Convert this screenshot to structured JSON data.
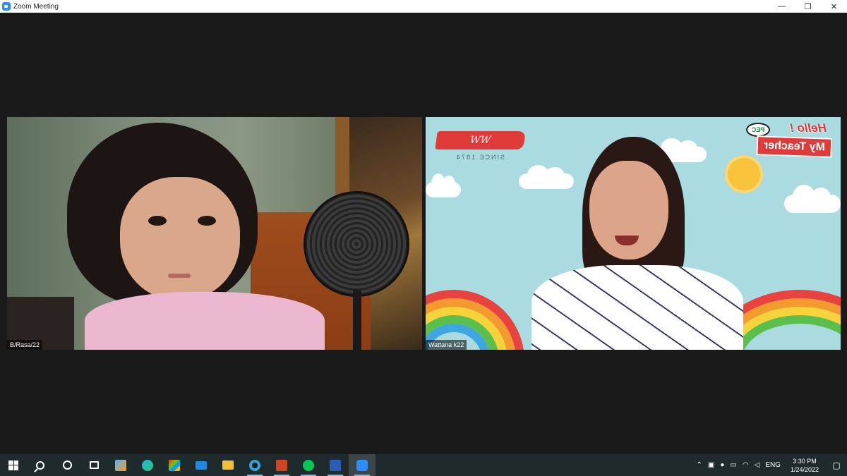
{
  "window": {
    "title": "Zoom Meeting",
    "controls": {
      "minimize": "—",
      "maximize": "❐",
      "close": "✕"
    }
  },
  "participants": [
    {
      "name": "B/Rasa/22"
    },
    {
      "name": "Wattana k22"
    }
  ],
  "background": {
    "logo_text": "WW",
    "since": "SINCE 1874",
    "hello": "Hello !",
    "teacher": "My Teacher",
    "bubble": "PEC"
  },
  "taskbar": {
    "apps": [
      "start-icon",
      "search-icon",
      "cortana-icon",
      "task-view-icon",
      "media-player-icon",
      "edge-icon",
      "store-icon",
      "mail-icon",
      "file-explorer-icon",
      "webex-icon",
      "powerpoint-icon",
      "line-icon",
      "word-icon",
      "zoom-icon"
    ],
    "tray": {
      "language": "ENG",
      "time": "3:30 PM",
      "date": "1/24/2022"
    }
  }
}
